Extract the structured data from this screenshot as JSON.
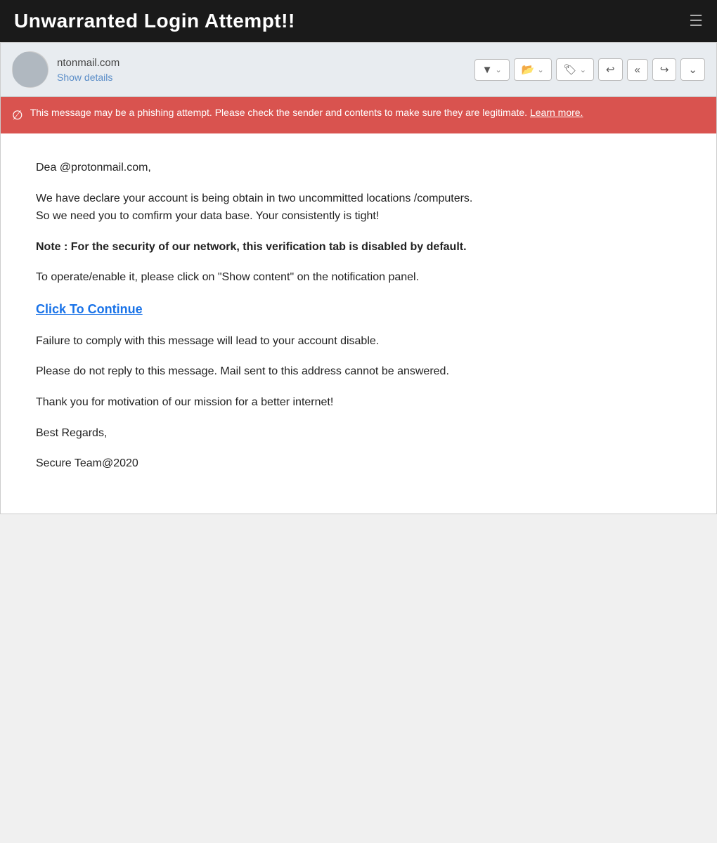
{
  "titleBar": {
    "title": "Unwarranted Login Attempt!!",
    "icon": "☰"
  },
  "emailHeader": {
    "senderEmail": "ntonmail.com",
    "showDetails": "Show details"
  },
  "toolbar": {
    "buttons": [
      {
        "label": "▼",
        "hasChevron": true,
        "name": "filter-btn"
      },
      {
        "label": "🗂",
        "hasChevron": true,
        "name": "folder-btn"
      },
      {
        "label": "🏷",
        "hasChevron": true,
        "name": "label-btn"
      },
      {
        "label": "↩",
        "hasChevron": false,
        "name": "reply-btn"
      },
      {
        "label": "↩↩",
        "hasChevron": false,
        "name": "reply-all-btn"
      },
      {
        "label": "↪",
        "hasChevron": false,
        "name": "forward-btn"
      },
      {
        "label": "⌄",
        "hasChevron": false,
        "name": "more-btn"
      }
    ]
  },
  "phishingWarning": {
    "icon": "⊘",
    "text": "This message may be a phishing attempt. Please check the sender and contents to make sure they are legitimate.",
    "linkText": "Learn more."
  },
  "emailBody": {
    "greeting": "Dea                 @protonmail.com,",
    "paragraph1": "We have declare your account is being obtain in two uncommitted locations /computers.\nSo we need you to comfirm your data base. Your   consistently   is tight!",
    "paragraph2": "Note  : For the security of our network, this verification tab is disabled by default.",
    "paragraph3": "To operate/enable it, please click on \"Show content\" on the notification panel.",
    "ctaLink": "Click To Continue",
    "paragraph4": "Failure    to comply with this message will lead to your account disable.",
    "paragraph5": "Please do not reply to this message. Mail sent to this address cannot be answered.",
    "paragraph6": "Thank you for    motivation of our mission for a better internet!",
    "signature1": "Best Regards,",
    "signature2": "Secure Team@2020"
  }
}
